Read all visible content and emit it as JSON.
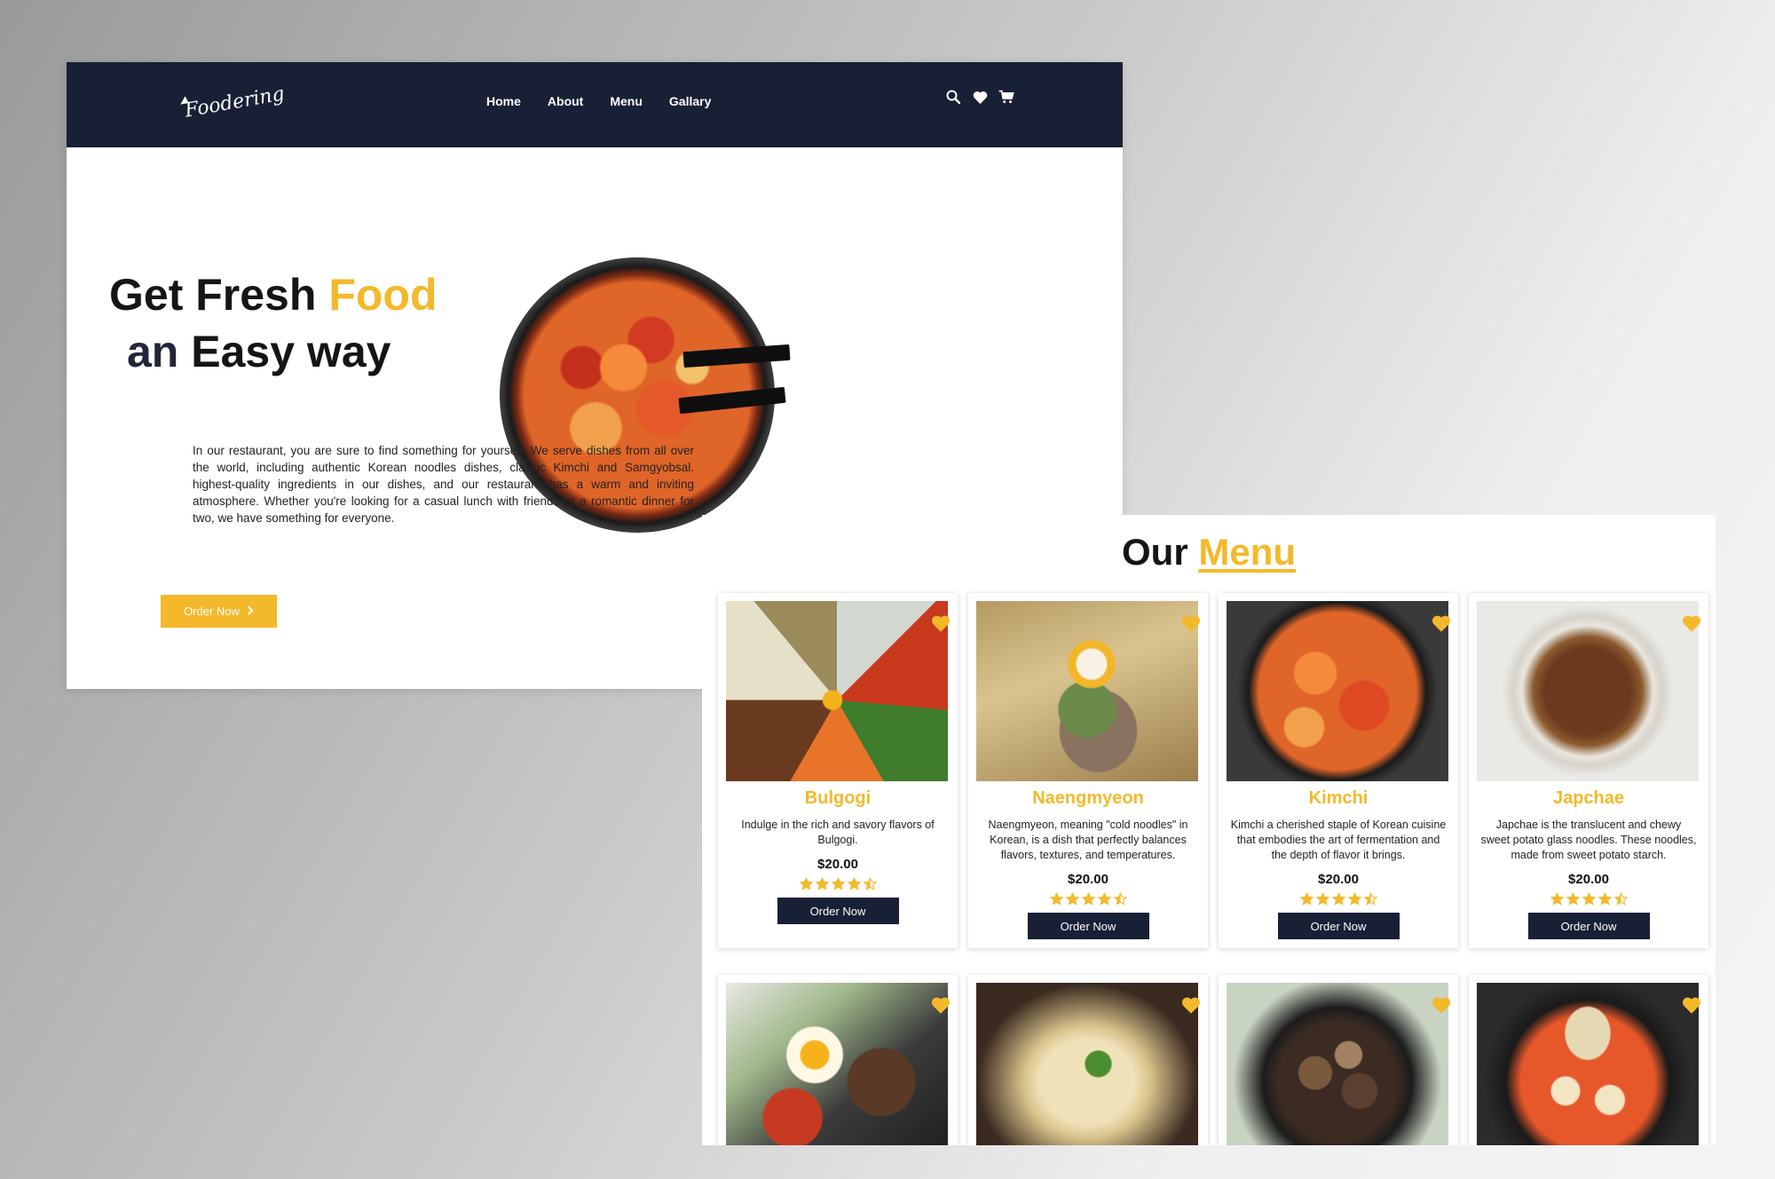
{
  "brand": {
    "logo_text": "Foodering"
  },
  "nav": {
    "links": [
      {
        "label": "Home"
      },
      {
        "label": "About"
      },
      {
        "label": "Menu"
      },
      {
        "label": "Gallary"
      }
    ],
    "icons": [
      "search-icon",
      "heart-icon",
      "cart-icon"
    ]
  },
  "hero": {
    "title_part1": "Get Fresh",
    "title_accent": "Food",
    "title_line2_muted": "an",
    "title_line2": "Easy way",
    "description": "In our restaurant, you are sure to find something for yourself. We serve dishes from all over the world, including authentic Korean noodles dishes, classic Kimchi and Samgyobsal. highest-quality ingredients in our dishes, and our restaurant has a warm and inviting atmosphere. Whether you're looking for a casual lunch with friends or a romantic dinner for two, we have something for everyone.",
    "button_label": "Order Now"
  },
  "menu": {
    "title": "Our",
    "title_accent": "Menu",
    "items": [
      {
        "name": "Bulgogi",
        "description": "Indulge in the rich and savory flavors of Bulgogi.",
        "price": "$20.00",
        "rating": 4.5,
        "button_label": "Order Now"
      },
      {
        "name": "Naengmyeon",
        "description": "Naengmyeon, meaning \"cold noodles\" in Korean, is a dish that perfectly balances flavors, textures, and temperatures.",
        "price": "$20.00",
        "rating": 4.5,
        "button_label": "Order Now"
      },
      {
        "name": "Kimchi",
        "description": "Kimchi a cherished staple of Korean cuisine that embodies the art of fermentation and the depth of flavor it brings.",
        "price": "$20.00",
        "rating": 4.5,
        "button_label": "Order Now"
      },
      {
        "name": "Japchae",
        "description": "Japchae is the translucent and chewy sweet potato glass noodles. These noodles, made from sweet potato starch.",
        "price": "$20.00",
        "rating": 4.5,
        "button_label": "Order Now"
      }
    ]
  },
  "colors": {
    "navy": "#182035",
    "accent": "#f4b92b"
  }
}
